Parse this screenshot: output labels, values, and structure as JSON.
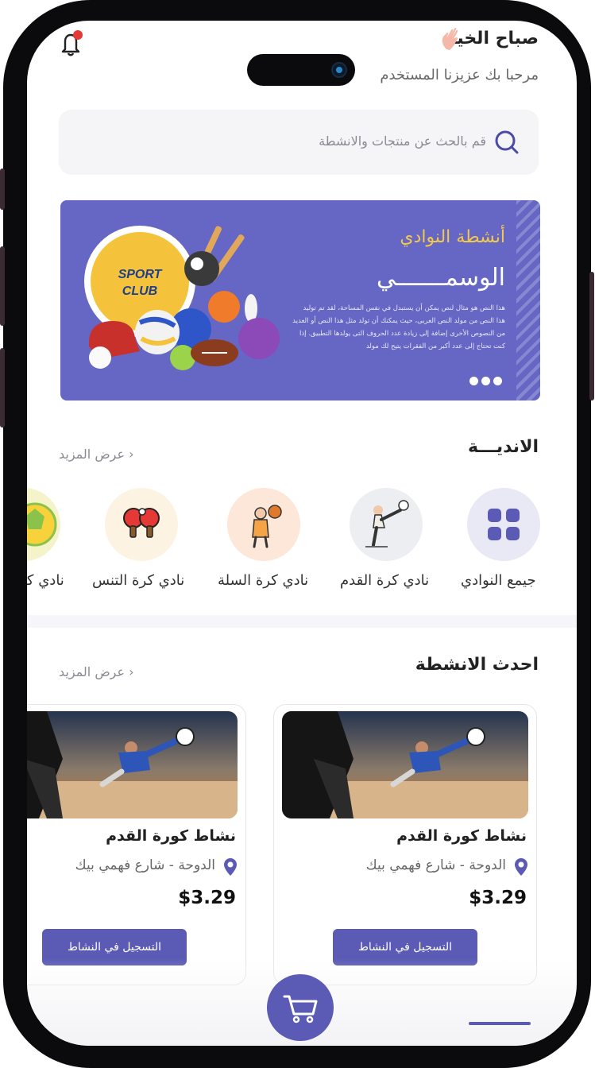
{
  "header": {
    "greeting": "صباح الخير",
    "subtitle": "مرحبا بك عزيزنا المستخدم"
  },
  "search": {
    "placeholder": "قم بالحث عن منتجات والانشطة"
  },
  "banner": {
    "title": "أنشطة النوادي",
    "subtitle": "الوسمـــــــي",
    "body": "هذا النص هو مثال لنص يمكن أن يستبدل في نفس المساحة، لقد تم توليد هذا النص من مولد النص العربى، حيث يمكنك أن تولد مثل هذا النص أو العديد من النصوص الأخرى إضافة إلى زيادة عدد الحروف التى يولدها التطبيق. إذا كنت تحتاج إلى عدد أكبر من الفقرات يتيح لك مولد",
    "logo_line1": "SPORT",
    "logo_line2": "CLUB",
    "social_icons": [
      "facebook-icon",
      "whatsapp-icon",
      "telegram-icon"
    ]
  },
  "clubs_section": {
    "title": "الانديـــة",
    "see_more": "عرض المزيد"
  },
  "clubs": [
    {
      "label": "جيمع النوادي",
      "icon": "grid-icon",
      "bg": "#e9e8f5"
    },
    {
      "label": "نادي كرة القدم",
      "icon": "football-player-icon",
      "bg": "#eceef1"
    },
    {
      "label": "نادي كرة السلة",
      "icon": "basketball-player-icon",
      "bg": "#fde7d8"
    },
    {
      "label": "نادي كرة التنس",
      "icon": "table-tennis-icon",
      "bg": "#fdf3e2"
    },
    {
      "label": "نادي كر",
      "icon": "ball-icon",
      "bg": "#f5f3c9"
    }
  ],
  "activities_section": {
    "title": "احدث الانشطة",
    "see_more": "عرض المزيد"
  },
  "activities": [
    {
      "title": "نشاط كورة القدم",
      "location": "الدوحة - شارع فهمي بيك",
      "price": "$3.29",
      "button": "التسجيل في النشاط"
    },
    {
      "title": "نشاط كورة القدم",
      "location": "الدوحة - شارع فهمي بيك",
      "price": "$3.29",
      "button": "التسجيل في النشاط"
    }
  ],
  "colors": {
    "accent": "#5b5bb6",
    "banner_bg": "#6667c4",
    "banner_title": "#f2c94c",
    "notification_dot": "#e53935"
  }
}
